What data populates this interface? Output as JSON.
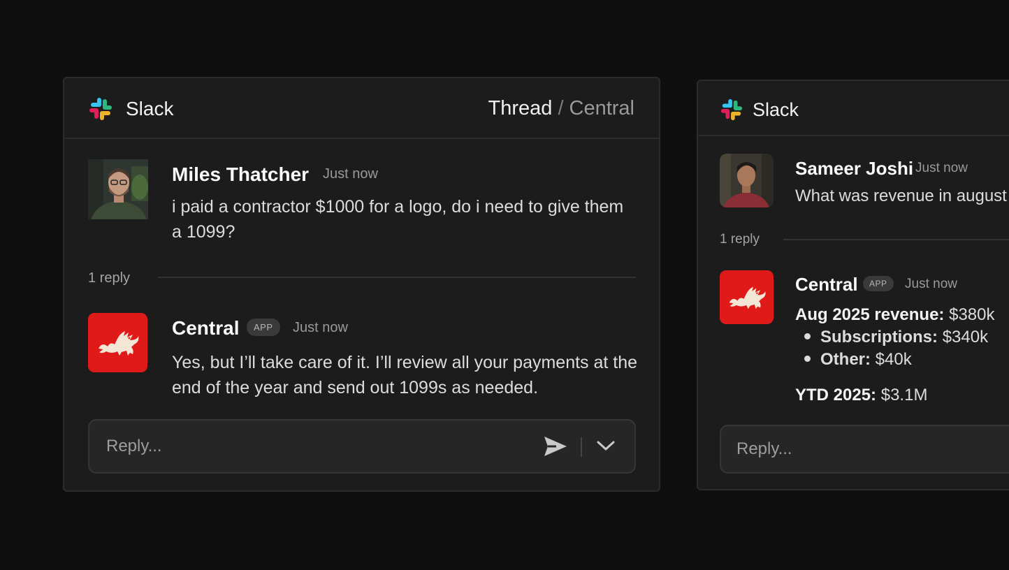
{
  "threads": [
    {
      "brand": "Slack",
      "breadcrumb": {
        "current": "Thread",
        "separator": "/",
        "channel": "Central"
      },
      "message": {
        "author": "Miles Thatcher",
        "time": "Just now",
        "text": "i paid a contractor $1000 for a logo, do i need to give them a 1099?"
      },
      "replies_label": "1 reply",
      "reply": {
        "author": "Central",
        "badge": "APP",
        "time": "Just now",
        "text": "Yes, but I’ll take care of it. I’ll review all your payments at the end of the year and send out 1099s as needed."
      },
      "input": {
        "placeholder": "Reply..."
      }
    },
    {
      "brand": "Slack",
      "message": {
        "author": "Sameer Joshi",
        "time": "Just now",
        "text": "What was revenue in august"
      },
      "replies_label": "1 reply",
      "reply": {
        "author": "Central",
        "badge": "APP",
        "time": "Just now",
        "revenue": {
          "aug_label": "Aug 2025 revenue:",
          "aug_value": "$380k",
          "items": [
            {
              "label": "Subscriptions:",
              "value": "$340k"
            },
            {
              "label": "Other:",
              "value": "$40k"
            }
          ],
          "ytd_label": "YTD 2025:",
          "ytd_value": "$3.1M"
        }
      },
      "input": {
        "placeholder": "Reply..."
      }
    }
  ],
  "colors": {
    "background": "#0f0f0f",
    "panel": "#1c1c1c",
    "app_red": "#e01919",
    "slack_blue": "#36c5f0",
    "slack_green": "#2eb67d",
    "slack_yellow": "#ecb22e",
    "slack_red": "#e01e5a"
  },
  "icons": [
    "slack-logo-icon",
    "dragon-icon",
    "send-icon",
    "chevron-down-icon"
  ]
}
